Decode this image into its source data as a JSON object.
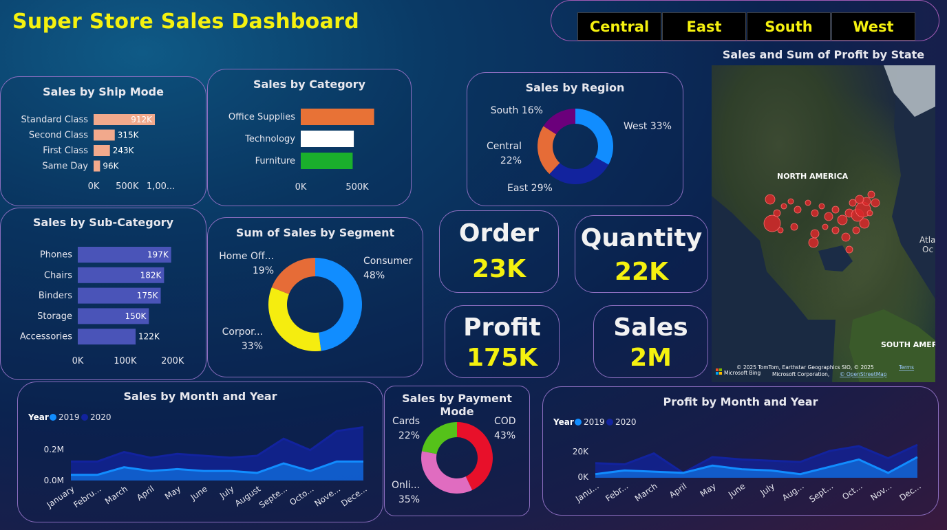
{
  "header": {
    "title": "Super Store Sales Dashboard"
  },
  "slicer": {
    "items": [
      "Central",
      "East",
      "South",
      "West"
    ]
  },
  "cards": {
    "ship_mode": "Sales by Ship Mode",
    "category": "Sales by Category",
    "region": "Sales by Region",
    "sub_category": "Sales by Sub-Category",
    "segment": "Sum of Sales by Segment",
    "month_year": "Sales by Month and Year",
    "payment": "Sales by Payment Mode",
    "profit_month": "Profit by Month and Year",
    "map": "Sales and Sum of Profit by State"
  },
  "kpis": {
    "order": {
      "label": "Order",
      "value": "23K"
    },
    "quantity": {
      "label": "Quantity",
      "value": "22K"
    },
    "profit": {
      "label": "Profit",
      "value": "175K"
    },
    "sales": {
      "label": "Sales",
      "value": "2M"
    }
  },
  "map": {
    "labels": {
      "north_america": "NORTH AMERICA",
      "south_america": "SOUTH AMER",
      "atlantic_1": "Atla",
      "atlantic_2": "Oc"
    },
    "bing": "Microsoft Bing",
    "attribution_1": "© 2025 TomTom, Earthstar Geographics SIO, © 2025",
    "attribution_2": "Microsoft Corporation,",
    "terms": "Terms",
    "osm": "© OpenStreetMap",
    "colors": {
      "bubble": "#d8282a"
    }
  },
  "chart_data": [
    {
      "id": "ship_mode",
      "type": "bar",
      "orientation": "horizontal",
      "color": "#f2a98c",
      "categories": [
        "Standard Class",
        "Second Class",
        "First Class",
        "Same Day"
      ],
      "values": [
        912,
        315,
        243,
        96
      ],
      "data_labels": [
        "912K",
        "315K",
        "243K",
        "96K"
      ],
      "x_ticks": [
        "0K",
        "500K",
        "1,00..."
      ],
      "xlim": [
        0,
        1250
      ],
      "unit": "K"
    },
    {
      "id": "category",
      "type": "bar",
      "orientation": "horizontal",
      "categories": [
        "Office Supplies",
        "Technology",
        "Furniture"
      ],
      "values": [
        650,
        470,
        460
      ],
      "colors": [
        "#e87236",
        "#ffffff",
        "#1aaf2c"
      ],
      "x_ticks": [
        "0K",
        "500K"
      ],
      "xlim": [
        0,
        1000
      ],
      "unit": "K"
    },
    {
      "id": "region",
      "type": "pie",
      "donut": true,
      "labels": [
        "West 33%",
        "East 29%",
        "Central 22%",
        "South 16%"
      ],
      "values": [
        33,
        29,
        22,
        16
      ],
      "colors": [
        "#118dff",
        "#12239e",
        "#e66c37",
        "#6b007b"
      ]
    },
    {
      "id": "sub_category",
      "type": "bar",
      "orientation": "horizontal",
      "color": "#4a54b8",
      "categories": [
        "Phones",
        "Chairs",
        "Binders",
        "Storage",
        "Accessories"
      ],
      "values": [
        197,
        182,
        175,
        150,
        122
      ],
      "data_labels": [
        "197K",
        "182K",
        "175K",
        "150K",
        "122K"
      ],
      "x_ticks": [
        "0K",
        "100K",
        "200K"
      ],
      "xlim": [
        0,
        225
      ],
      "unit": "K"
    },
    {
      "id": "segment",
      "type": "pie",
      "donut": true,
      "labels": [
        "Consumer 48%",
        "Corpor... 33%",
        "Home Off... 19%"
      ],
      "values": [
        48,
        33,
        19
      ],
      "colors": [
        "#118dff",
        "#f5ed0f",
        "#e66c37"
      ]
    },
    {
      "id": "sales_month",
      "type": "area",
      "legend_title": "Year",
      "x": [
        "January",
        "Febru...",
        "March",
        "April",
        "May",
        "June",
        "July",
        "August",
        "Septe...",
        "Octo...",
        "Nove...",
        "Dece..."
      ],
      "y_ticks": [
        "0.2M",
        "0.0M"
      ],
      "ylim": [
        0,
        0.3
      ],
      "series": [
        {
          "name": "2019",
          "color": "#118dff",
          "values": [
            0.03,
            0.03,
            0.07,
            0.05,
            0.06,
            0.05,
            0.05,
            0.04,
            0.09,
            0.05,
            0.1,
            0.1
          ]
        },
        {
          "name": "2020",
          "color": "#12239e",
          "values": [
            0.1,
            0.1,
            0.15,
            0.12,
            0.14,
            0.13,
            0.12,
            0.13,
            0.22,
            0.16,
            0.26,
            0.28
          ]
        }
      ]
    },
    {
      "id": "payment",
      "type": "pie",
      "donut": true,
      "labels": [
        "COD 43%",
        "Onli... 35%",
        "Cards 22%"
      ],
      "values": [
        43,
        35,
        22
      ],
      "colors": [
        "#e8102a",
        "#e06cc0",
        "#55c21a"
      ]
    },
    {
      "id": "profit_month",
      "type": "area",
      "legend_title": "Year",
      "x": [
        "Janu...",
        "Febr...",
        "March",
        "April",
        "May",
        "June",
        "July",
        "Aug...",
        "Sept...",
        "Oct...",
        "Nov...",
        "Dec..."
      ],
      "y_ticks": [
        "20K",
        "0K"
      ],
      "ylim": [
        0,
        35
      ],
      "series": [
        {
          "name": "2019",
          "color": "#118dff",
          "values": [
            3,
            6,
            5,
            4,
            10,
            7,
            6,
            3,
            9,
            15,
            4,
            17
          ]
        },
        {
          "name": "2020",
          "color": "#12239e",
          "values": [
            12,
            11,
            20,
            4,
            17,
            15,
            14,
            13,
            22,
            26,
            16,
            27
          ]
        }
      ]
    }
  ]
}
